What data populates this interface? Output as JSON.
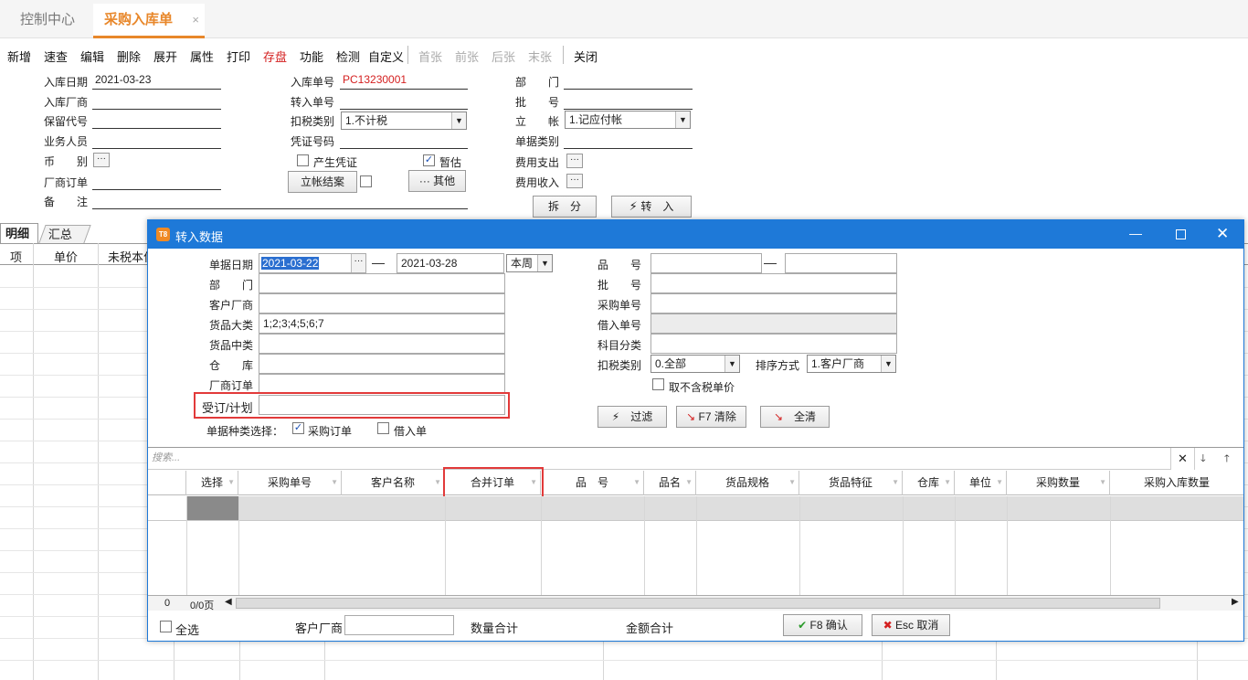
{
  "tabs": {
    "control": "控制中心",
    "active": "采购入库单",
    "close": "×"
  },
  "toolbar": {
    "items": [
      "新增",
      "速查",
      "编辑",
      "删除",
      "展开",
      "属性",
      "打印",
      "存盘",
      "功能",
      "检测",
      "自定义"
    ],
    "nav": [
      "首张",
      "前张",
      "后张",
      "末张"
    ],
    "close": "关闭"
  },
  "form": {
    "col1": {
      "labels": [
        "入库日期",
        "入库厂商",
        "保留代号",
        "业务人员",
        "币　　别",
        "厂商订单",
        "备　　注"
      ],
      "date": "2021-03-23"
    },
    "col2": {
      "labels": [
        "入库单号",
        "转入单号",
        "扣税类别",
        "凭证号码"
      ],
      "order_no": "PC13230001",
      "tax_type": "1.不计税",
      "gen_voucher": "产生凭证",
      "estimate": "暂估",
      "settle_btn": "立帐结案",
      "other_btn": "其他"
    },
    "col3": {
      "labels": [
        "部　　门",
        "批　　号",
        "立　　帐",
        "单据类别",
        "费用支出",
        "费用收入"
      ],
      "account": "1.记应付帐",
      "split_btn": "拆　分",
      "transfer_btn": "转　入"
    }
  },
  "detail": {
    "tabs": [
      "明细",
      "汇总"
    ],
    "headers": [
      "项",
      "单价",
      "未税本位"
    ]
  },
  "dialog": {
    "title": "转入数据",
    "icon": "T8",
    "left": {
      "date_label": "单据日期",
      "date_from": "2021-03-22",
      "dash": "—",
      "date_to": "2021-03-28",
      "period": "本周",
      "labels": [
        "部　　门",
        "客户厂商",
        "货品大类",
        "货品中类",
        "仓　　库",
        "厂商订单",
        "受订/计划"
      ],
      "category": "1;2;3;4;5;6;7",
      "doc_type_label": "单据种类选择：",
      "po_check": "采购订单",
      "borrow_check": "借入单"
    },
    "right": {
      "labels": [
        "品　　号",
        "批　　号",
        "采购单号",
        "借入单号",
        "科目分类",
        "扣税类别"
      ],
      "tax_type": "0.全部",
      "sort_label": "排序方式",
      "sort_value": "1.客户厂商",
      "no_tax_price": "取不含税单价",
      "filter_btn": "过滤",
      "clear_btn": "F7 清除",
      "clearall_btn": "全清"
    },
    "search_placeholder": "搜索...",
    "grid_headers": [
      "选择",
      "采购单号",
      "客户名称",
      "合并订单",
      "品　号",
      "品名",
      "货品规格",
      "货品特征",
      "仓库",
      "单位",
      "采购数量",
      "采购入库数量"
    ],
    "pager": {
      "count": "0",
      "pages": "0/0页"
    },
    "footer": {
      "select_all": "全选",
      "customer_label": "客户厂商",
      "qty_total": "数量合计",
      "amt_total": "金额合计",
      "ok_btn": "F8 确认",
      "cancel_btn": "Esc 取消"
    }
  }
}
